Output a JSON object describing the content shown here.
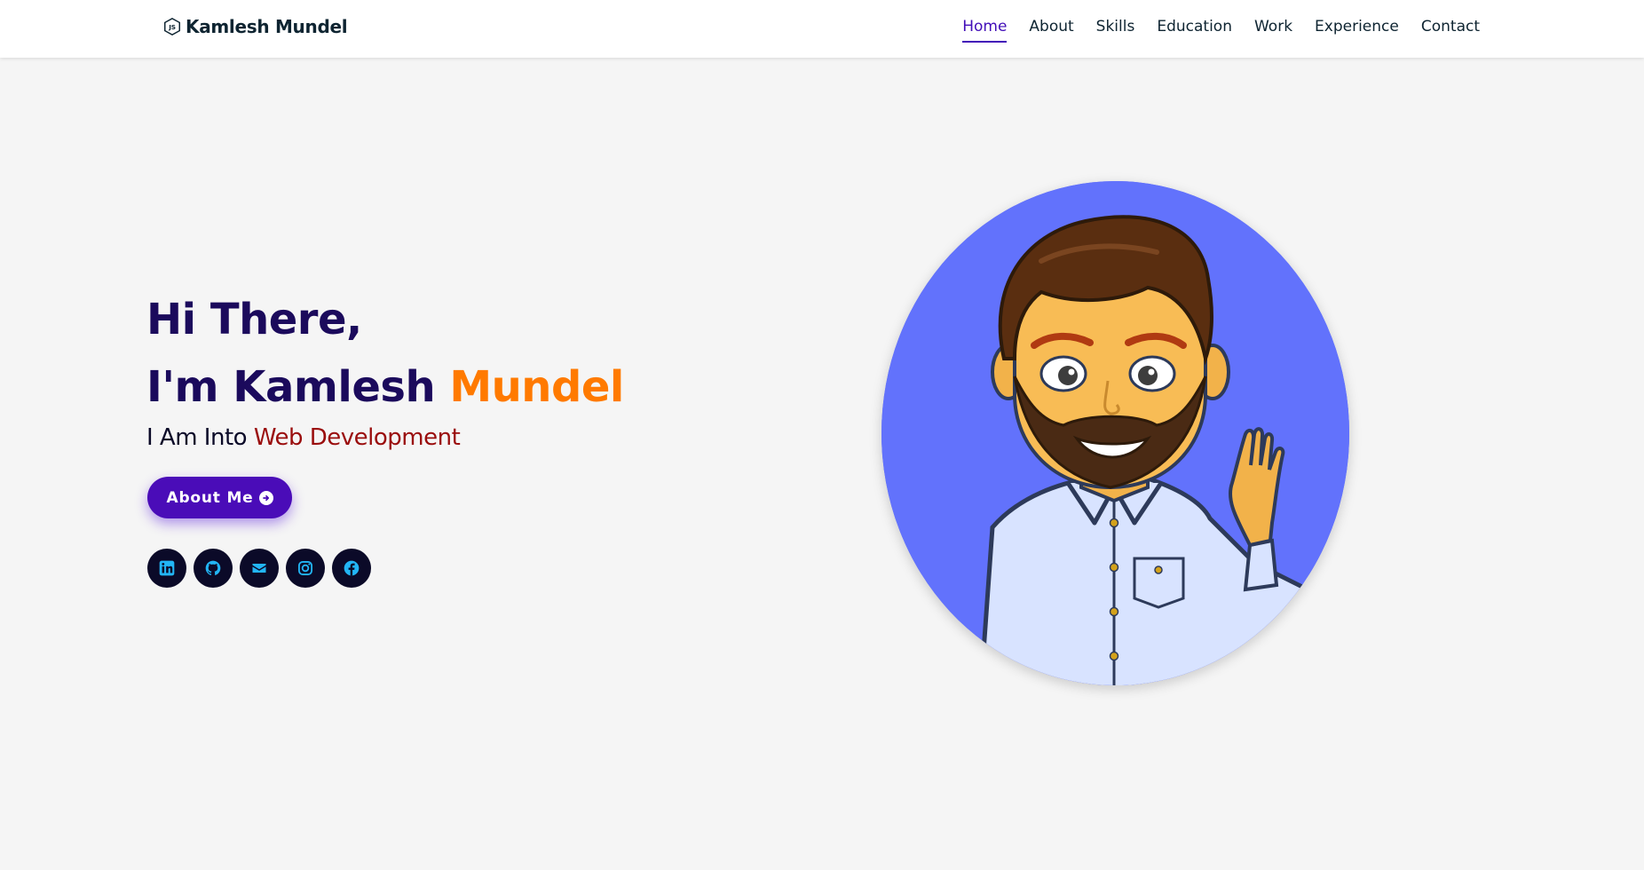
{
  "brand": {
    "name": "Kamlesh Mundel",
    "icon": "nodejs-icon"
  },
  "nav": {
    "items": [
      {
        "label": "Home",
        "active": true
      },
      {
        "label": "About",
        "active": false
      },
      {
        "label": "Skills",
        "active": false
      },
      {
        "label": "Education",
        "active": false
      },
      {
        "label": "Work",
        "active": false
      },
      {
        "label": "Experience",
        "active": false
      },
      {
        "label": "Contact",
        "active": false
      }
    ]
  },
  "hero": {
    "line1": "Hi There,",
    "line2_prefix": "I'm Kamlesh ",
    "line2_accent": "Mundel",
    "tagline_prefix": "I Am Into ",
    "tagline_typed": "Web Development",
    "button_label": "About Me",
    "button_icon": "arrow-circle-right-icon",
    "avatar_icon": "waving-avatar-illustration"
  },
  "socials": [
    {
      "icon": "linkedin-icon"
    },
    {
      "icon": "github-icon"
    },
    {
      "icon": "envelope-icon"
    },
    {
      "icon": "instagram-icon"
    },
    {
      "icon": "facebook-icon"
    }
  ],
  "colors": {
    "accent": "#420eb8",
    "name_accent": "#ff7a00",
    "typed_text": "#9a0d0d",
    "heading": "#1b0a5c",
    "social_bg": "#0b0a28",
    "social_icon": "#22b5f5",
    "avatar_bg": "#6272fc",
    "page_bg": "#f5f5f5"
  }
}
